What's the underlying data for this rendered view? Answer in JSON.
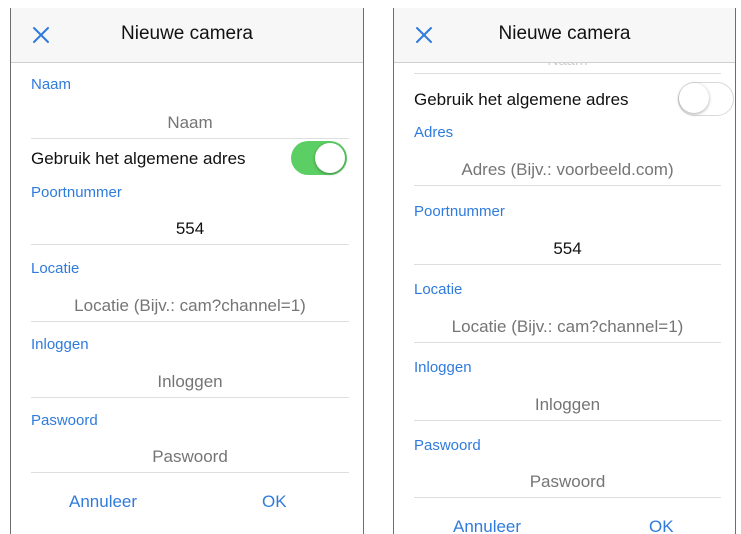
{
  "left": {
    "title": "Nieuwe camera",
    "naam": {
      "label": "Naam",
      "placeholder": "Naam"
    },
    "toggle": {
      "label": "Gebruik het algemene adres",
      "state": "on"
    },
    "poort": {
      "label": "Poortnummer",
      "value": "554"
    },
    "locatie": {
      "label": "Locatie",
      "placeholder": "Locatie (Bijv.: cam?channel=1)"
    },
    "inloggen": {
      "label": "Inloggen",
      "placeholder": "Inloggen"
    },
    "paswoord": {
      "label": "Paswoord",
      "placeholder": "Paswoord"
    },
    "cancel": "Annuleer",
    "ok": "OK"
  },
  "right": {
    "title": "Nieuwe camera",
    "cut_placeholder": "Naam",
    "toggle": {
      "label": "Gebruik het algemene adres",
      "state": "off"
    },
    "adres": {
      "label": "Adres",
      "placeholder": "Adres (Bijv.: voorbeeld.com)"
    },
    "poort": {
      "label": "Poortnummer",
      "value": "554"
    },
    "locatie": {
      "label": "Locatie",
      "placeholder": "Locatie (Bijv.: cam?channel=1)"
    },
    "inloggen": {
      "label": "Inloggen",
      "placeholder": "Inloggen"
    },
    "paswoord": {
      "label": "Paswoord",
      "placeholder": "Paswoord"
    },
    "cancel": "Annuleer",
    "ok": "OK"
  },
  "colors": {
    "accent": "#2f7bdc",
    "switch_on": "#5ccf64"
  }
}
